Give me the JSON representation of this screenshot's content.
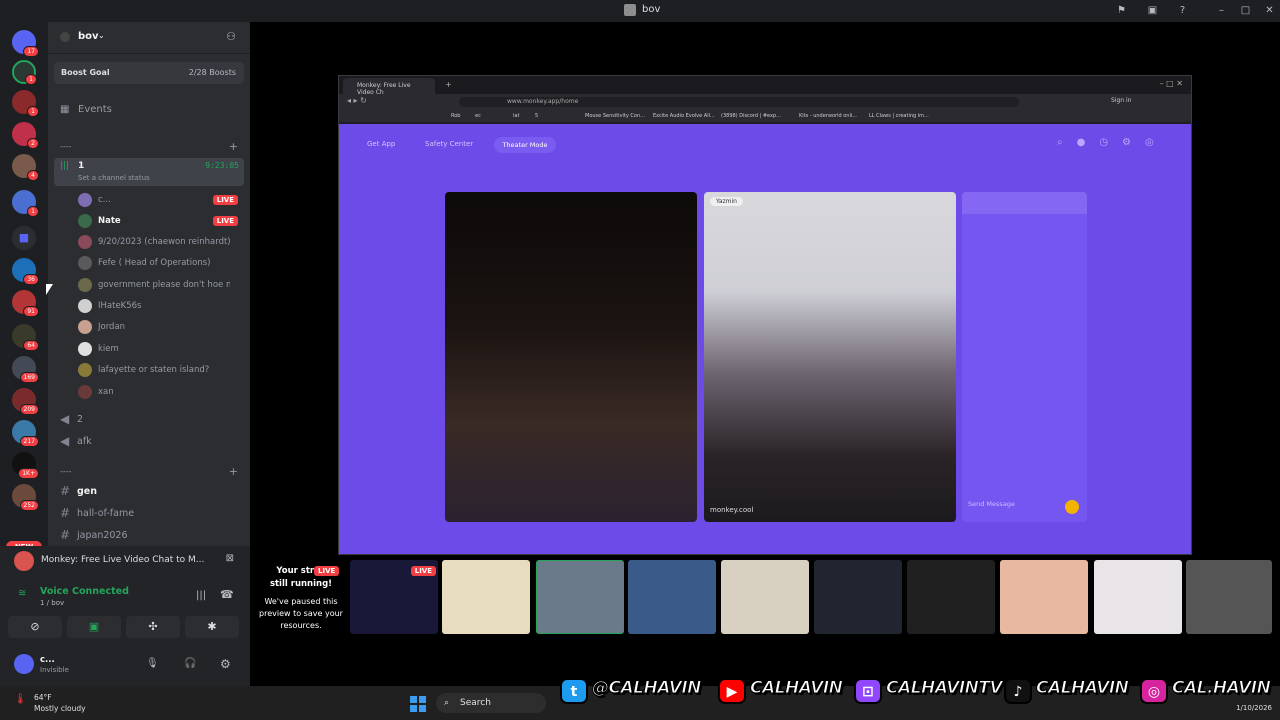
{
  "window": {
    "title": "bov"
  },
  "guilds": [
    {
      "badge": "17"
    },
    {
      "badge": "1"
    },
    {
      "badge": "1"
    },
    {
      "badge": "2"
    },
    {
      "badge": "4"
    },
    {
      "badge": "1"
    },
    {
      "badge": ""
    },
    {
      "badge": "36"
    },
    {
      "badge": "91"
    },
    {
      "badge": "64"
    },
    {
      "badge": "169"
    },
    {
      "badge": "209"
    },
    {
      "badge": "217"
    },
    {
      "badge": "1K+"
    },
    {
      "badge": "252"
    }
  ],
  "guilds_new": "NEW",
  "server": {
    "name": "bov"
  },
  "boost": {
    "label": "Boost Goal",
    "progress": "2/28 Boosts"
  },
  "events": "Events",
  "categories": {
    "c1": "----",
    "c2": "----"
  },
  "voice_channel": {
    "name": "1",
    "timer": "9:23:05",
    "status": "Set a channel status"
  },
  "users": [
    {
      "name": "c...",
      "live": "LIVE"
    },
    {
      "name": "Nate",
      "live": "LIVE"
    },
    {
      "name": "9/20/2023 (chaewon reinhardt)"
    },
    {
      "name": "Fefe ( Head of Operations)"
    },
    {
      "name": "government please don't hoe me"
    },
    {
      "name": "IHateK56s"
    },
    {
      "name": "Jordan"
    },
    {
      "name": "kiem"
    },
    {
      "name": "lafayette or staten island?"
    },
    {
      "name": "xan"
    }
  ],
  "voice_channels": [
    {
      "name": "2"
    },
    {
      "name": "afk"
    }
  ],
  "text_channels": [
    {
      "name": "gen"
    },
    {
      "name": "hall-of-fame"
    },
    {
      "name": "japan2026"
    }
  ],
  "stream_title": "Monkey: Free Live Video Chat to M...",
  "voice": {
    "connected": "Voice Connected",
    "sub": "1 / bov"
  },
  "me": {
    "name": "c...",
    "status": "Invisible"
  },
  "browser": {
    "tab": "Monkey: Free Live Video Ch",
    "url": "www.monkey.app/home",
    "signin": "Sign in",
    "bookmarks": [
      "Rob",
      "ec",
      "lat",
      "5",
      "Mouse Sensitivity Con...",
      "Excite Audio Evolve All...",
      "(3898) Discord | #exp...",
      "Kits - underworld onli...",
      "LL Claws | creating im..."
    ]
  },
  "page": {
    "nav": [
      "Get App",
      "Safety Center"
    ],
    "theater": "Theater Mode",
    "video_user": "Yazmin",
    "watermark": "monkey.cool",
    "send_message": "Send Message"
  },
  "preview": {
    "line1": "Your strea",
    "line2": "still running!",
    "sub": "We've paused this preview to save your resources.",
    "live": "LIVE",
    "live2": "LIVE"
  },
  "taskbar": {
    "temp": "64°F",
    "weather": "Mostly cloudy",
    "search": "Search",
    "date": "1/10/2026"
  },
  "socials": {
    "twitter": "@CALHAVIN",
    "youtube": "CALHAVIN",
    "twitch": "CALHAVINTV",
    "tiktok": "CALHAVIN",
    "instagram": "CAL.HAVIN"
  }
}
